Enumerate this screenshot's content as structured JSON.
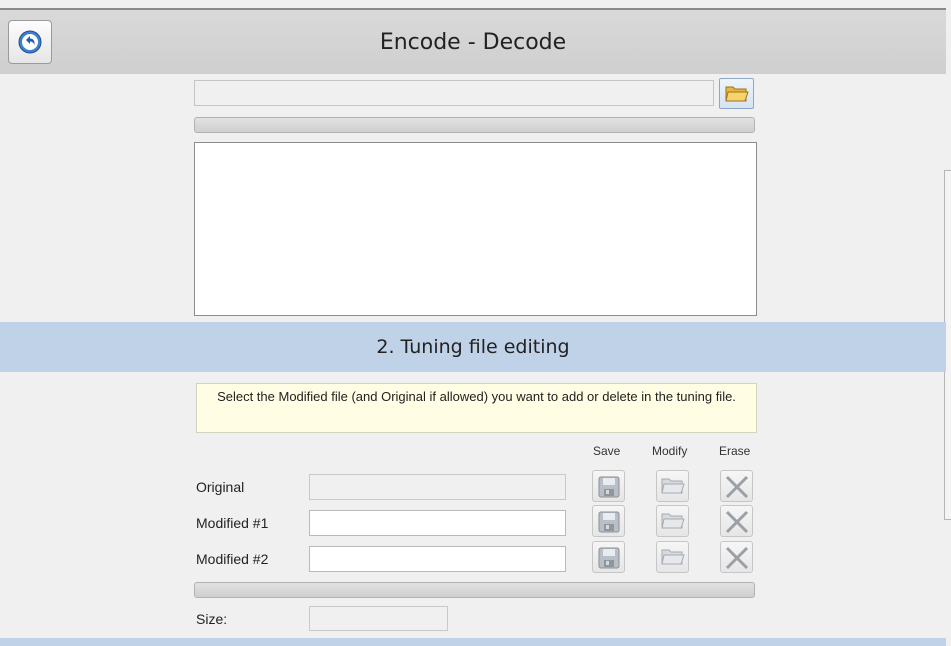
{
  "header": {
    "title": "Encode - Decode",
    "back_icon": "back-arrow-icon"
  },
  "file_section": {
    "file_path_value": "",
    "browse_icon": "folder-open-icon"
  },
  "tuning_section": {
    "title": "2. Tuning file editing",
    "notice": "Select the Modified file (and Original if allowed) you want to add or delete in the tuning file.",
    "columns": {
      "save": "Save",
      "modify": "Modify",
      "erase": "Erase"
    },
    "rows": [
      {
        "label": "Original",
        "value": "",
        "enabled": false
      },
      {
        "label": "Modified #1",
        "value": "",
        "enabled": true
      },
      {
        "label": "Modified #2",
        "value": "",
        "enabled": true
      }
    ],
    "size_label": "Size:",
    "size_value": ""
  },
  "colors": {
    "header_bg": "#d3d3d3",
    "section_bg": "#bfd2e8",
    "notice_bg": "#fffde3"
  }
}
